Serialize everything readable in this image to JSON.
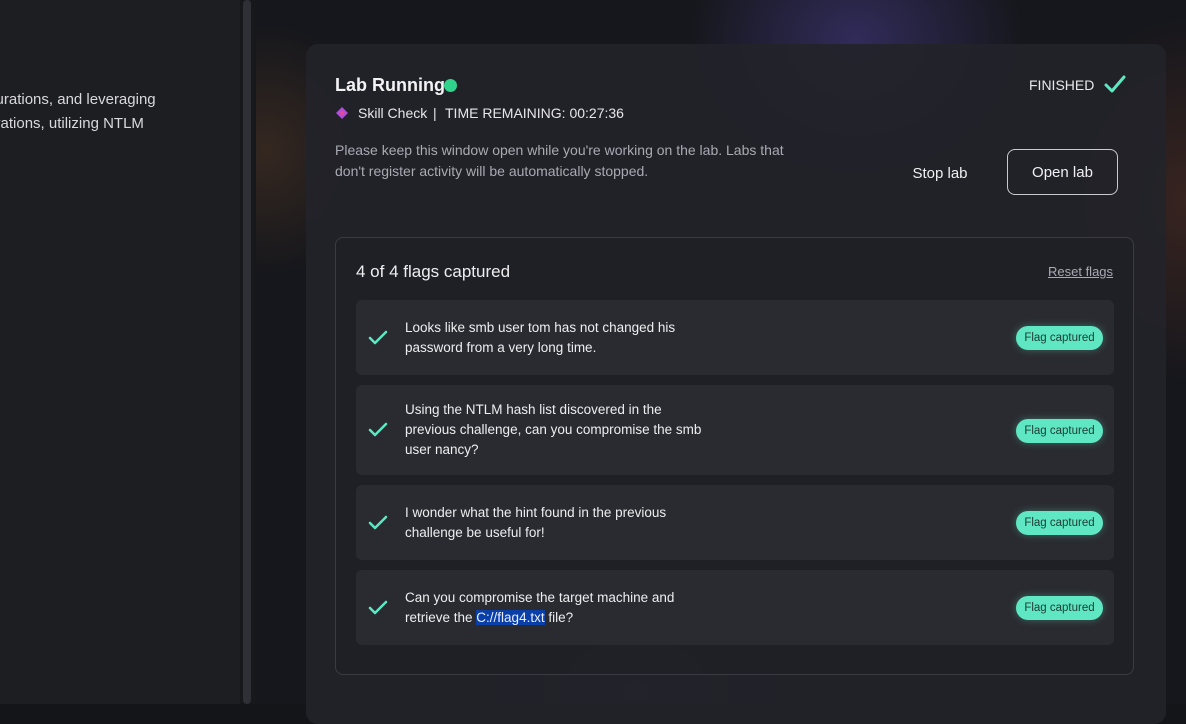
{
  "left_pane": {
    "lines": [
      "onfigurations, and leveraging",
      "nfigurations, utilizing NTLM"
    ]
  },
  "lab": {
    "title": "Lab Running",
    "status_color": "#2fd38b",
    "skill_label": "Skill Check",
    "separator": "|",
    "time_remaining": "TIME REMAINING: 00:27:36",
    "notice": "Please keep this window open while you're working on the lab. Labs that don't register activity will be automatically stopped.",
    "finished_label": "FINISHED",
    "stop_button": "Stop lab",
    "open_button": "Open lab"
  },
  "flags": {
    "count_label": "4 of 4 flags captured",
    "reset_label": "Reset flags",
    "badge_color": "#5fe7c4",
    "items": [
      {
        "text": "Looks like smb user tom has not changed his password from a very long time.",
        "badge": "Flag captured"
      },
      {
        "text": "Using the NTLM hash list discovered in the previous challenge, can you compromise the smb user nancy?",
        "badge": "Flag captured"
      },
      {
        "text": "I wonder what the hint found in the previous challenge be useful for!",
        "badge": "Flag captured"
      },
      {
        "text_before": "Can you compromise the target machine and retrieve the ",
        "text_highlight": "C://flag4.txt",
        "text_after": " file?",
        "badge": "Flag captured"
      }
    ]
  }
}
